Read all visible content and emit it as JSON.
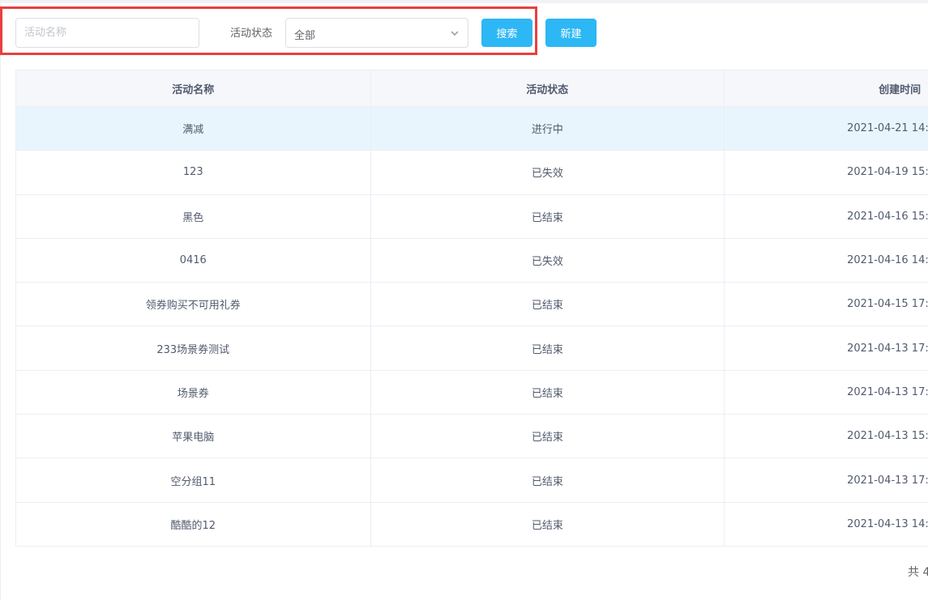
{
  "filter": {
    "name_placeholder": "活动名称",
    "status_label": "活动状态",
    "status_value": "全部",
    "search_label": "搜索",
    "new_label": "新建"
  },
  "table": {
    "headers": [
      "活动名称",
      "活动状态",
      "创建时间"
    ],
    "rows": [
      {
        "name": "满减",
        "status": "进行中",
        "created": "2021-04-21 14:"
      },
      {
        "name": "123",
        "status": "已失效",
        "created": "2021-04-19 15:"
      },
      {
        "name": "黑色",
        "status": "已结束",
        "created": "2021-04-16 15:"
      },
      {
        "name": "0416",
        "status": "已失效",
        "created": "2021-04-16 14:"
      },
      {
        "name": "领券购买不可用礼券",
        "status": "已结束",
        "created": "2021-04-15 17:"
      },
      {
        "name": "233场景券测试",
        "status": "已结束",
        "created": "2021-04-13 17:"
      },
      {
        "name": "场景券",
        "status": "已结束",
        "created": "2021-04-13 17:"
      },
      {
        "name": "苹果电脑",
        "status": "已结束",
        "created": "2021-04-13 15:"
      },
      {
        "name": "空分组11",
        "status": "已结束",
        "created": "2021-04-13 17:"
      },
      {
        "name": "酷酷的12",
        "status": "已结束",
        "created": "2021-04-13 14:"
      }
    ]
  },
  "pager": {
    "total_text": "共 4"
  },
  "colors": {
    "primary": "#2db7f5",
    "highlight": "#e8403f",
    "active_row": "#e8f5fd"
  }
}
